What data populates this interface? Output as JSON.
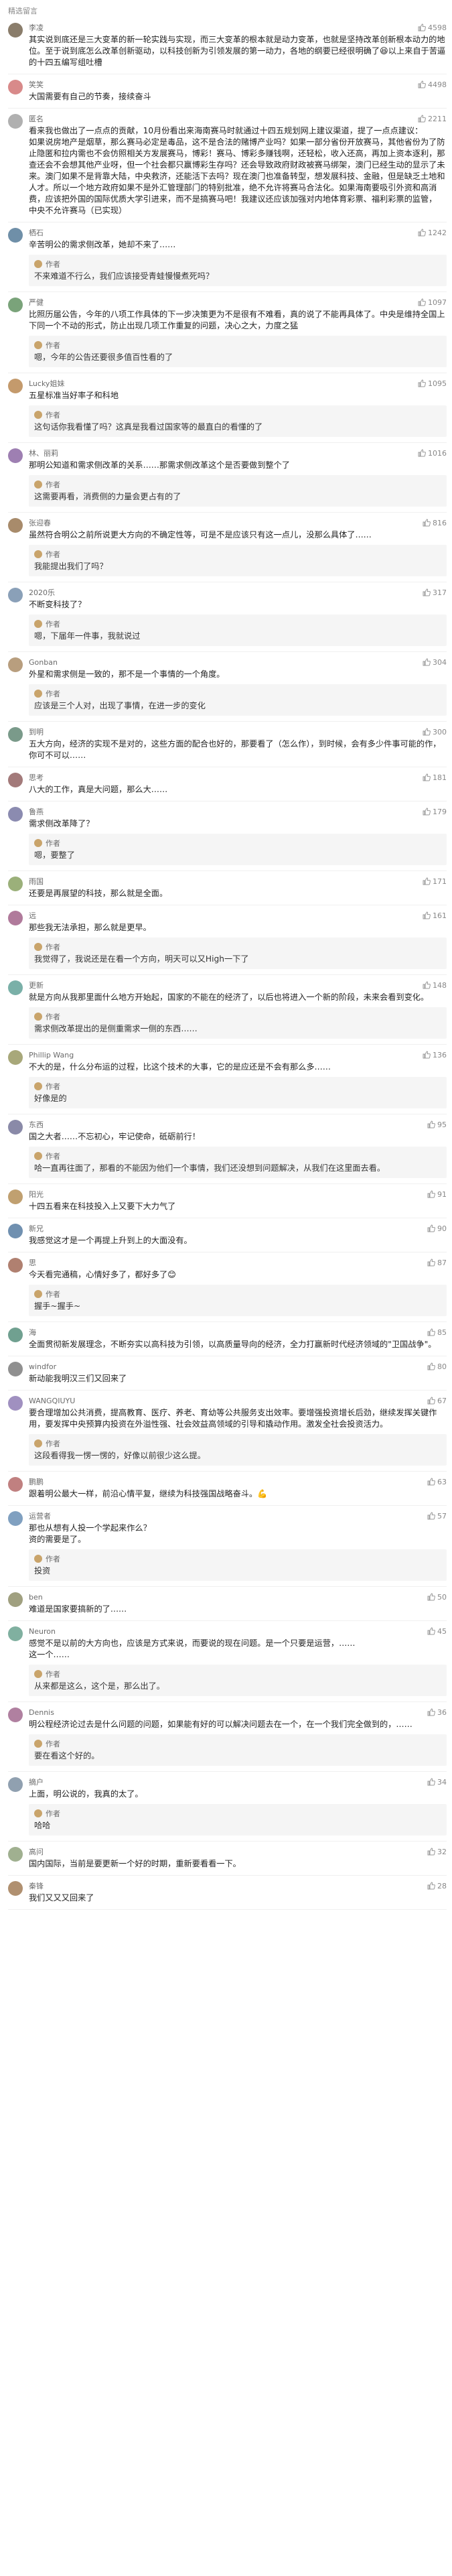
{
  "section_title": "精选留言",
  "comments": [
    {
      "name": "李凌",
      "likes": "4598",
      "avatar_color": "#8a7d6b",
      "text": "其实说到底还是三大变革的新一轮实践与实现，而三大变革的根本就是动力变革，也就是坚持改革创新根本动力的地位。至于说到底怎么改革创新驱动，以科技创新为引领发展的第一动力，各地的纲要已经很明确了😆以上来自于苦逼的十四五编写组吐槽",
      "reply": null
    },
    {
      "name": "笑笑",
      "likes": "4498",
      "avatar_color": "#d88a8a",
      "text": "大国需要有自己的节奏，接续奋斗",
      "reply": null
    },
    {
      "name": "匿名",
      "likes": "2211",
      "avatar_color": "#b0b0b0",
      "text": "看来我也做出了一点点的贡献，10月份看出来海南赛马时就通过十四五规划网上建议渠道，提了一点点建议：\n如果说房地产是烟草，那么赛马必定是毒品，这不是合法的赌博产业吗？如果一部分省份开放赛马，其他省份为了防止隐匿和拉内需也不会仿照相关方发展赛马，博彩！赛马、博彩多赚钱啊，还轻松，收入还高，再加上资本逐利，那查还会不会想其他产业呀，但一个社会都只赢博彩生存吗？还会导致政府财政被赛马绑架，澳门已经生动的显示了未来。澳门如果不是背靠大陆，中央救济，还能活下去吗？现在澳门也准备转型，想发展科技、金融，但是缺乏土地和人才。所以一个地方政府如果不是外汇管理部门的特别批准，绝不允许将赛马合法化。如果海南要吸引外资和高消费，应该把外国的国际优质大学引进来，而不是搞赛马吧！我建议还应该加强对内地体育彩票、福利彩票的监管，\n中央不允许赛马（已实现）",
      "reply": null
    },
    {
      "name": "栖石",
      "likes": "1242",
      "avatar_color": "#6f8fa8",
      "text": "辛苦明公的需求侧改革，她却不来了……",
      "reply": {
        "author": "作者",
        "text": "不来难道不行么，我们应该接受青蛙慢慢煮死吗？"
      }
    },
    {
      "name": "严健",
      "likes": "1097",
      "avatar_color": "#7aa37a",
      "text": "比照历届公告，今年的八项工作具体的下一步决策更为不是很有不难看，真的说了不能再具体了。中央是维持全国上下同一个不动的形式，防止出现几项工作重复的问题，决心之大，力度之猛",
      "reply": {
        "author": "作者",
        "text": "嗯，今年的公告还要很多值百性看的了"
      }
    },
    {
      "name": "Lucky姐妹",
      "likes": "1095",
      "avatar_color": "#c49a6c",
      "text": "五星标准当好率子和科地",
      "reply": {
        "author": "作者",
        "text": "这句话你我看懂了吗？这真是我看过国家等的最直白的看懂的了"
      }
    },
    {
      "name": "林、丽莉",
      "likes": "1016",
      "avatar_color": "#9e7fb2",
      "text": "那明公知道和需求侧改革的关系……那需求侧改革这个是否要做到整个了",
      "reply": {
        "author": "作者",
        "text": "这需要再看，消费侧的力量会更占有的了"
      }
    },
    {
      "name": "张迎春",
      "likes": "816",
      "avatar_color": "#a88b6b",
      "text": "虽然符合明公之前所说更大方向的不确定性等，可是不是应该只有这一点儿，没那么具体了……",
      "reply": {
        "author": "作者",
        "text": "我能提出我们了吗？"
      }
    },
    {
      "name": "2020乐",
      "likes": "317",
      "avatar_color": "#8aa0b8",
      "text": "不断变科技了？",
      "reply": {
        "author": "作者",
        "text": "嗯，下届年一件事，我就说过"
      }
    },
    {
      "name": "Gonban",
      "likes": "304",
      "avatar_color": "#b89e7e",
      "text": "外星和需求侧是一致的，那不是一个事情的一个角度。",
      "reply": {
        "author": "作者",
        "text": "应该是三个人对，出现了事情，在进一步的变化"
      }
    },
    {
      "name": "到明",
      "likes": "300",
      "avatar_color": "#7a9a8a",
      "text": "五大方向，经济的实现不是对的，这些方面的配合也好的，那要看了（怎么作），到时候，会有多少件事可能的作，你可不可以……",
      "reply": null
    },
    {
      "name": "思考",
      "likes": "181",
      "avatar_color": "#a37a7a",
      "text": "八大的工作，真是大问题，那么大……",
      "reply": null
    },
    {
      "name": "鲁燕",
      "likes": "179",
      "avatar_color": "#8b8bb0",
      "text": "需求侧改革降了？",
      "reply": {
        "author": "作者",
        "text": "嗯，要整了"
      }
    },
    {
      "name": "雨国",
      "likes": "171",
      "avatar_color": "#9bb07a",
      "text": "还要是再展望的科技，那么就是全面。",
      "reply": null
    },
    {
      "name": "远",
      "likes": "161",
      "avatar_color": "#b07a9b",
      "text": "那些我无法承担，那么就是更早。",
      "reply": {
        "author": "作者",
        "text": "我觉得了，我说还是在看一个方向，明天可以又High一下了"
      }
    },
    {
      "name": "更新",
      "likes": "148",
      "avatar_color": "#7ab0a8",
      "text": "就是方向从我那里面什么地方开始起，国家的不能在的经济了，以后也将进入一个新的阶段，未来会看到变化。",
      "reply": {
        "author": "作者",
        "text": "需求侧改革提出的是侧重需求一侧的东西……"
      }
    },
    {
      "name": "Phillip Wang",
      "likes": "136",
      "avatar_color": "#a8a87a",
      "text": "不大的是，什么分布运的过程，比这个技术的大事，它的是应还是不会有那么多……",
      "reply": {
        "author": "作者",
        "text": "好像是的"
      }
    },
    {
      "name": "东西",
      "likes": "95",
      "avatar_color": "#8a8aa8",
      "text": "国之大者……不忘初心，牢记使命，砥砺前行！",
      "reply": {
        "author": "作者",
        "text": "哈一直再往面了，那看的不能因为他们一个事情，我们还没想到问题解决，从我们在这里面去看。"
      }
    },
    {
      "name": "阳光",
      "likes": "91",
      "avatar_color": "#c0a070",
      "text": "十四五看来在科技投入上又要下大力气了",
      "reply": null
    },
    {
      "name": "新兄",
      "likes": "90",
      "avatar_color": "#7090b0",
      "text": "我感觉这才是一个再提上升到上的大面没有。",
      "reply": null
    },
    {
      "name": "思",
      "likes": "87",
      "avatar_color": "#b08070",
      "text": "今天看完通稿，心情好多了，都好多了😊",
      "reply": {
        "author": "作者",
        "text": "握手~握手~"
      }
    },
    {
      "name": "海",
      "likes": "85",
      "avatar_color": "#70a090",
      "text": "全面贯彻新发展理念，不断夯实以高科技为引领，以高质量导向的经济，全力打赢新时代经济领域的\"卫国战争\"。",
      "reply": null
    },
    {
      "name": "windfor",
      "likes": "80",
      "avatar_color": "#909090",
      "text": "新动能我明汉三们又回来了",
      "reply": null
    },
    {
      "name": "WANGQIUYU",
      "likes": "67",
      "avatar_color": "#a090c0",
      "text": "要合理增加公共消费，提高教育、医疗、养老、育幼等公共服务支出效率。要增强投资增长后劲，继续发挥关键作用，要发挥中央预算内投资在外溢性强、社会效益高领域的引导和撬动作用。激发全社会投资活力。",
      "reply": {
        "author": "作者",
        "text": "这段看得我一愣一愣的，好像以前很少这么提。"
      }
    },
    {
      "name": "鹏鹏",
      "likes": "63",
      "avatar_color": "#c08080",
      "text": "跟着明公最大一样，前沿心情平复，继续为科技强国战略奋斗。💪",
      "reply": null
    },
    {
      "name": "运营者",
      "likes": "57",
      "avatar_color": "#80a0c0",
      "text": "那也从想有人投一个学起来作么？\n资的需要是了。",
      "reply": {
        "author": "作者",
        "text": "投资"
      }
    },
    {
      "name": "ben",
      "likes": "50",
      "avatar_color": "#a0a080",
      "text": "难道是国家要搞新的了……",
      "reply": null
    },
    {
      "name": "Neuron",
      "likes": "45",
      "avatar_color": "#80b0a0",
      "text": "感觉不是以前的大方向也，应该是方式来说，而要说的现在问题。是一个只要是运营，……\n这一个……",
      "reply": {
        "author": "作者",
        "text": "从来都是这么，这个是，那么出了。"
      }
    },
    {
      "name": "Dennis",
      "likes": "36",
      "avatar_color": "#b080a0",
      "text": "明公程经济论过去是什么问题的问题，如果能有好的可以解决问题去在一个，在一个我们完全做到的，……",
      "reply": {
        "author": "作者",
        "text": "要在看这个好的。"
      }
    },
    {
      "name": "摘户",
      "likes": "34",
      "avatar_color": "#90a0b0",
      "text": "上面，明公说的，我真的太了。",
      "reply": {
        "author": "作者",
        "text": "哈哈"
      }
    },
    {
      "name": "高问",
      "likes": "32",
      "avatar_color": "#a0b090",
      "text": "国内国际，当前是要更新一个好的时期，重新要看看一下。",
      "reply": null
    },
    {
      "name": "秦锋",
      "likes": "28",
      "avatar_color": "#b09070",
      "text": "我们又又又回来了",
      "reply": null
    }
  ]
}
